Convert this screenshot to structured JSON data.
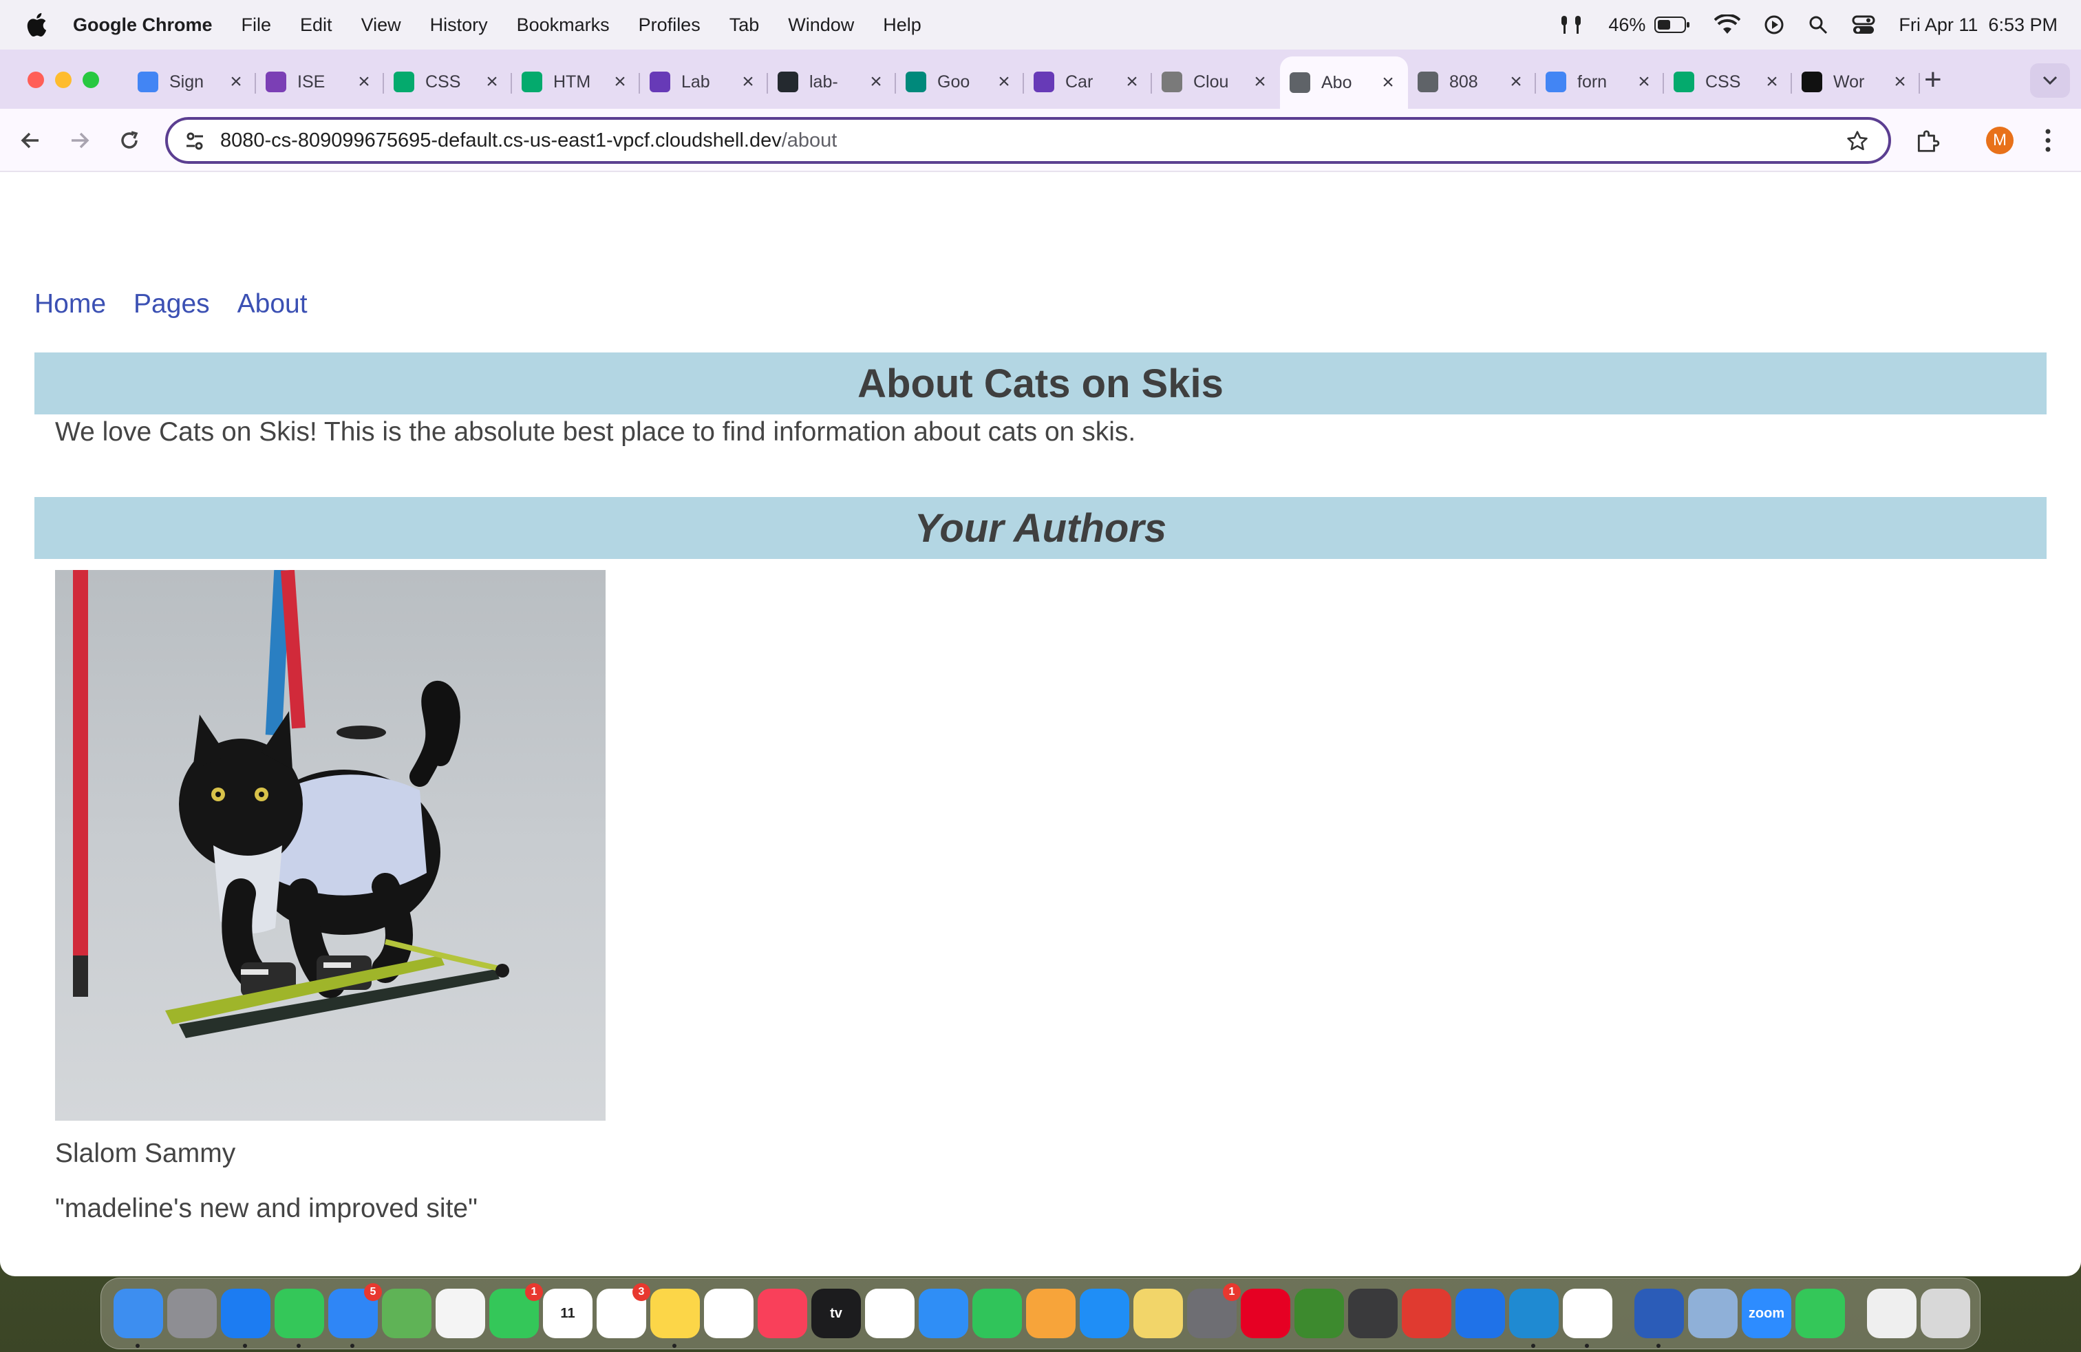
{
  "menubar": {
    "app": "Google Chrome",
    "items": [
      "File",
      "Edit",
      "View",
      "History",
      "Bookmarks",
      "Profiles",
      "Tab",
      "Window",
      "Help"
    ],
    "battery": "46%",
    "datetime": "Fri Apr 11  6:53 PM"
  },
  "tabs": [
    {
      "label": "Sign",
      "icon": "google-icon",
      "color": "#4285f4"
    },
    {
      "label": "ISE",
      "icon": "ed-icon",
      "color": "#7b3fb5"
    },
    {
      "label": "CSS",
      "icon": "w3schools-icon",
      "color": "#04aa6d"
    },
    {
      "label": "HTM",
      "icon": "w3schools-icon",
      "color": "#04aa6d"
    },
    {
      "label": "Lab",
      "icon": "forms-icon",
      "color": "#673ab7"
    },
    {
      "label": "lab-",
      "icon": "github-icon",
      "color": "#24292f"
    },
    {
      "label": "Goo",
      "icon": "meet-icon",
      "color": "#00897b"
    },
    {
      "label": "Car",
      "icon": "forms-icon",
      "color": "#673ab7"
    },
    {
      "label": "Clou",
      "icon": "cloudshell-icon",
      "color": "#7a7a7a"
    },
    {
      "label": "Abo",
      "icon": "globe-icon",
      "color": "#5f6368",
      "active": true
    },
    {
      "label": "808",
      "icon": "globe-icon",
      "color": "#5f6368"
    },
    {
      "label": "forn",
      "icon": "google-icon",
      "color": "#4285f4"
    },
    {
      "label": "CSS",
      "icon": "w3schools-icon",
      "color": "#04aa6d"
    },
    {
      "label": "Wor",
      "icon": "chatgpt-icon",
      "color": "#111111"
    }
  ],
  "omnibox": {
    "host": "8080-cs-809099675695-default.cs-us-east1-vpcf.cloudshell.dev",
    "path": "/about"
  },
  "profile_initial": "M",
  "site": {
    "nav": [
      "Home",
      "Pages",
      "About"
    ],
    "title": "About Cats on Skis",
    "intro": "We love Cats on Skis! This is the absolute best place to find information about cats on skis.",
    "authors_heading": "Your Authors",
    "author_name": "Slalom Sammy",
    "author_quote": "\"madeline's new and improved site\""
  },
  "colors": {
    "banner": "#b3d6e3",
    "link": "#3b50b3",
    "text": "#444444",
    "omnibox_border": "#5b3e91",
    "tabstrip": "#e6dcf3"
  },
  "dock": [
    {
      "name": "finder-icon",
      "color": "#3d8ef0",
      "running": true
    },
    {
      "name": "launchpad-icon",
      "color": "#8e8e93"
    },
    {
      "name": "safari-icon",
      "color": "#1c7cf2",
      "running": true
    },
    {
      "name": "messages-icon",
      "color": "#34c759",
      "running": true
    },
    {
      "name": "mail-icon",
      "color": "#2f86f6",
      "badge": "5",
      "running": true
    },
    {
      "name": "maps-icon",
      "color": "#5fb356"
    },
    {
      "name": "photos-icon",
      "color": "#f4f4f4"
    },
    {
      "name": "facetime-icon",
      "color": "#34c759",
      "badge": "1"
    },
    {
      "name": "calendar-icon",
      "color": "#ffffff",
      "label": "11"
    },
    {
      "name": "reminders-icon",
      "color": "#ffffff",
      "badge": "3"
    },
    {
      "name": "notes-icon",
      "color": "#fcd648",
      "running": true
    },
    {
      "name": "freeform-icon",
      "color": "#ffffff"
    },
    {
      "name": "music-icon",
      "color": "#f9405a"
    },
    {
      "name": "tv-icon",
      "color": "#1c1c1e",
      "label": "tv"
    },
    {
      "name": "news-icon",
      "color": "#ffffff"
    },
    {
      "name": "keynote-icon",
      "color": "#2f8ef6"
    },
    {
      "name": "numbers-icon",
      "color": "#30c45a"
    },
    {
      "name": "pages-icon",
      "color": "#f7a43a"
    },
    {
      "name": "app-store-icon",
      "color": "#1f8ef6"
    },
    {
      "name": "stickies-icon",
      "color": "#f2d569"
    },
    {
      "name": "system-settings-icon",
      "color": "#6e6e73",
      "badge": "1"
    },
    {
      "name": "pinterest-icon",
      "color": "#e60023"
    },
    {
      "name": "minecraft-icon",
      "color": "#3d8a2e"
    },
    {
      "name": "keychain-icon",
      "color": "#3a3a3c"
    },
    {
      "name": "canvas-icon",
      "color": "#e03a30"
    },
    {
      "name": "xcode-icon",
      "color": "#1f72e8"
    },
    {
      "name": "vscode-icon",
      "color": "#1f8ad2",
      "running": true
    },
    {
      "name": "chrome-icon",
      "color": "#ffffff",
      "running": true
    },
    {
      "name": "word-icon",
      "color": "#2b5cb8",
      "running": true
    },
    {
      "name": "preview-icon",
      "color": "#8fb0d8"
    },
    {
      "name": "zoom-icon",
      "color": "#2d8cff",
      "label": "zoom"
    },
    {
      "name": "messages-alt-icon",
      "color": "#34c759"
    },
    {
      "name": "text-file-icon",
      "color": "#efefef"
    },
    {
      "name": "trash-icon",
      "color": "#d8d8d8"
    }
  ]
}
